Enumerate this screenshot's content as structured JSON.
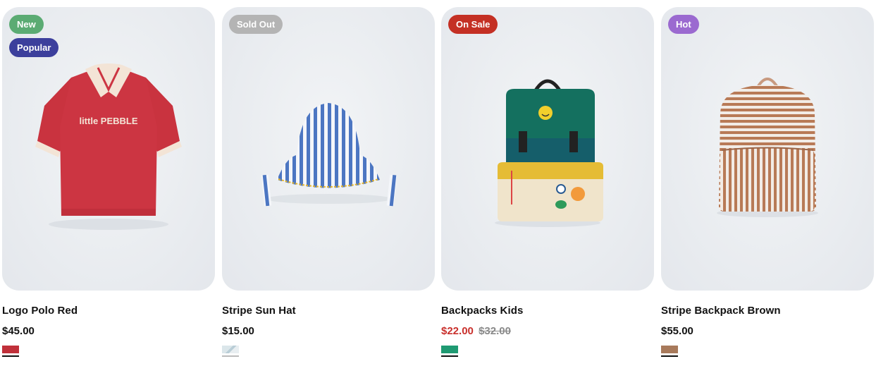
{
  "products": [
    {
      "name": "Logo Polo Red",
      "price": "$45.00",
      "old_price": "",
      "badges": [
        {
          "label": "New",
          "color": "#5bab73"
        },
        {
          "label": "Popular",
          "color": "#3c3f9c"
        }
      ],
      "image_icon": "red-polo-shirt",
      "shirt_text": "little PEBBLE",
      "swatch_color": "#c0303a"
    },
    {
      "name": "Stripe Sun Hat",
      "price": "$15.00",
      "old_price": "",
      "badges": [
        {
          "label": "Sold Out",
          "color": "#b4b4b4"
        }
      ],
      "image_icon": "striped-bucket-hat",
      "swatch_color": "#dbe6ea"
    },
    {
      "name": "Backpacks Kids",
      "price": "$22.00",
      "old_price": "$32.00",
      "badges": [
        {
          "label": "On Sale",
          "color": "#c43024"
        }
      ],
      "image_icon": "green-kids-backpack",
      "swatch_color": "#1f9a72"
    },
    {
      "name": "Stripe Backpack Brown",
      "price": "$55.00",
      "old_price": "",
      "badges": [
        {
          "label": "Hot",
          "color": "#9b6ad0"
        }
      ],
      "image_icon": "brown-striped-backpack",
      "swatch_color": "#a87a5b"
    }
  ]
}
